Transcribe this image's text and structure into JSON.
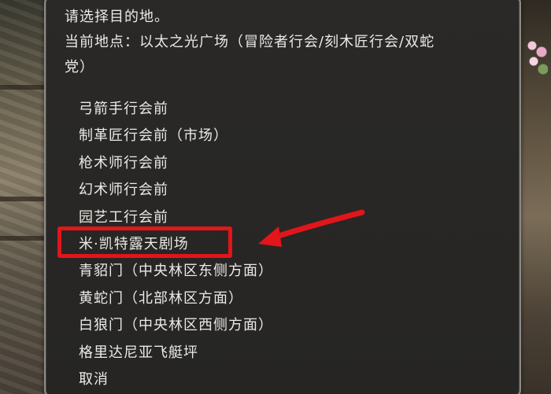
{
  "dialog": {
    "prompt": "请选择目的地。",
    "current_location_line1": "当前地点：以太之光广场（冒险者行会/刻木匠行会/双蛇",
    "current_location_line2": "党）",
    "options": [
      {
        "label": "弓箭手行会前"
      },
      {
        "label": "制革匠行会前（市场）"
      },
      {
        "label": "枪术师行会前"
      },
      {
        "label": "幻术师行会前"
      },
      {
        "label": "园艺工行会前"
      },
      {
        "label": "米·凯特露天剧场",
        "highlighted": true
      },
      {
        "label": "青貂门（中央林区东侧方面）"
      },
      {
        "label": "黄蛇门（北部林区方面）"
      },
      {
        "label": "白狼门（中央林区西侧方面）"
      },
      {
        "label": "格里达尼亚飞艇坪"
      },
      {
        "label": "取消"
      }
    ]
  },
  "annotation": {
    "color": "#e2151b"
  }
}
